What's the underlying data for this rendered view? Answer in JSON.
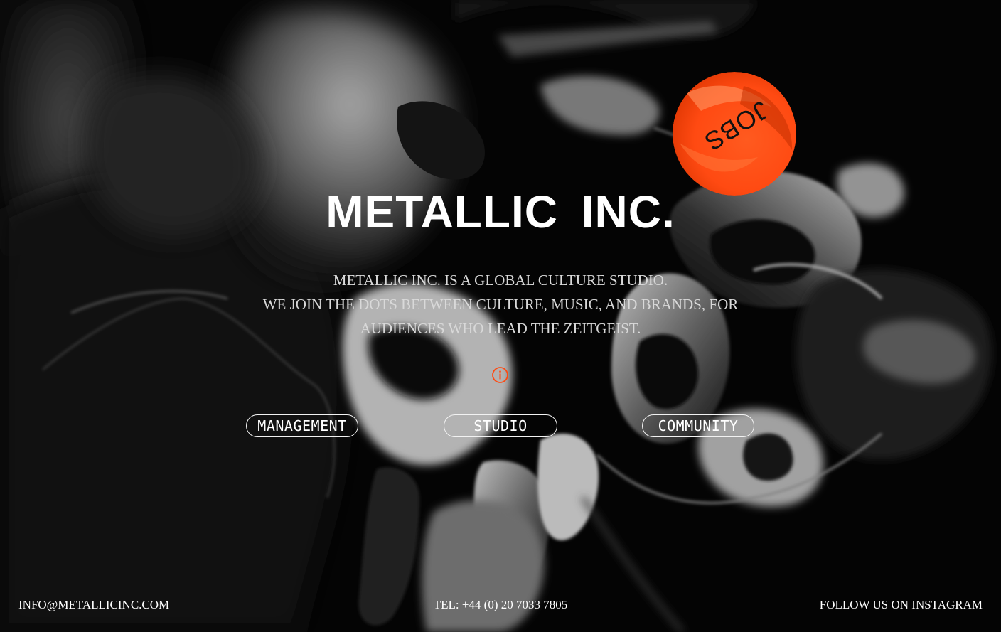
{
  "brand": {
    "title": "METALLIC  INC.",
    "accent": "#ff4a12"
  },
  "jobs_badge": {
    "label": "JOBS"
  },
  "hero": {
    "description_lines": [
      "METALLIC INC. IS A GLOBAL CULTURE STUDIO.",
      "WE JOIN THE DOTS BETWEEN CULTURE, MUSIC, AND BRANDS, FOR",
      "AUDIENCES WHO LEAD THE ZEITGEIST."
    ],
    "info_icon": "info-circle-icon"
  },
  "nav": {
    "items": [
      {
        "label": "MANAGEMENT"
      },
      {
        "label": "STUDIO"
      },
      {
        "label": "COMMUNITY"
      }
    ]
  },
  "footer": {
    "email": "INFO@METALLICINC.COM",
    "tel": "TEL: +44 (0) 20 7033 7805",
    "instagram": "FOLLOW US ON INSTAGRAM"
  }
}
